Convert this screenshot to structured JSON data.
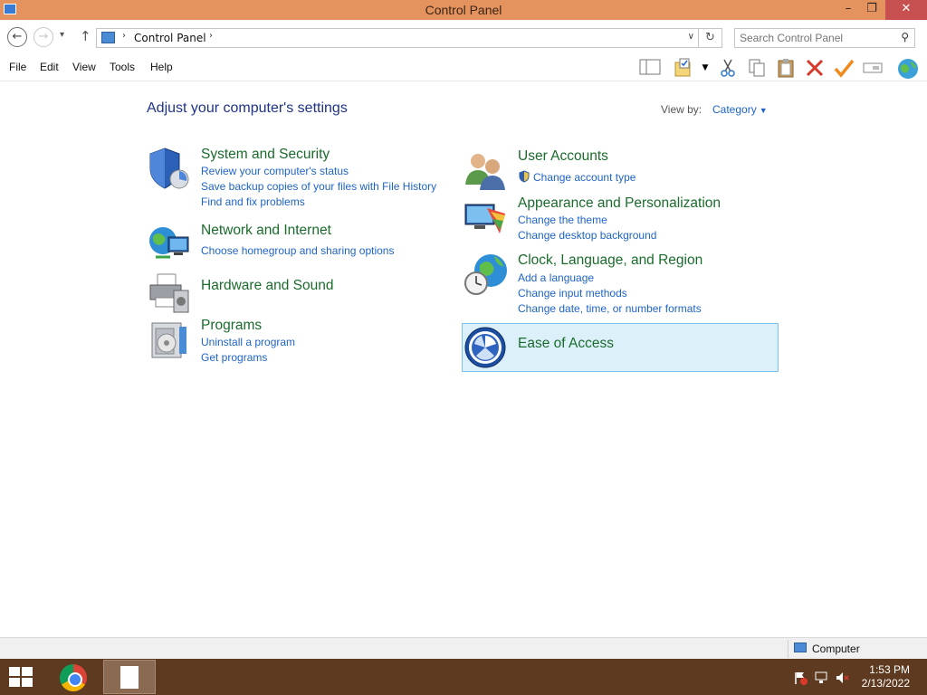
{
  "window": {
    "title": "Control Panel",
    "minimize_glyph": "–",
    "maximize_glyph": "❐",
    "close_glyph": "✕"
  },
  "address": {
    "back_glyph": "←",
    "forward_glyph": "→",
    "recent_glyph": "▾",
    "up_glyph": "↑",
    "breadcrumb": "Control Panel",
    "sep_glyph": "›",
    "dropdown_glyph": "∨",
    "refresh_glyph": "↻"
  },
  "search": {
    "placeholder": "Search Control Panel",
    "icon_glyph": "⚲"
  },
  "menu": [
    "File",
    "Edit",
    "View",
    "Tools",
    "Help"
  ],
  "toolbar": {
    "icons": [
      "layout-icon",
      "properties-icon",
      "cut-icon",
      "copy-icon",
      "paste-icon",
      "delete-icon",
      "checkmark-icon",
      "rename-icon",
      "globe-icon"
    ]
  },
  "main": {
    "heading": "Adjust your computer's settings",
    "view_by_label": "View by:",
    "view_by_value": "Category",
    "categories_left": [
      {
        "title": "System and Security",
        "links": [
          "Review your computer's status",
          "Save backup copies of your files with File History",
          "Find and fix problems"
        ]
      },
      {
        "title": "Network and Internet",
        "links": [
          "Choose homegroup and sharing options"
        ]
      },
      {
        "title": "Hardware and Sound",
        "links": []
      },
      {
        "title": "Programs",
        "links": [
          "Uninstall a program",
          "Get programs"
        ]
      }
    ],
    "categories_right": [
      {
        "title": "User Accounts",
        "links": [
          "Change account type"
        ]
      },
      {
        "title": "Appearance and Personalization",
        "links": [
          "Change the theme",
          "Change desktop background"
        ]
      },
      {
        "title": "Clock, Language, and Region",
        "links": [
          "Add a language",
          "Change input methods",
          "Change date, time, or number formats"
        ]
      },
      {
        "title": "Ease of Access",
        "links": []
      }
    ]
  },
  "status": {
    "location": "Computer"
  },
  "taskbar": {
    "time": "1:53 PM",
    "date": "2/13/2022"
  },
  "colors": {
    "titlebar": "#e5935e",
    "taskbar": "#5e3a20",
    "category_title": "#1a6b2c",
    "link": "#1e64c8",
    "highlight": "#dcf0fa"
  }
}
